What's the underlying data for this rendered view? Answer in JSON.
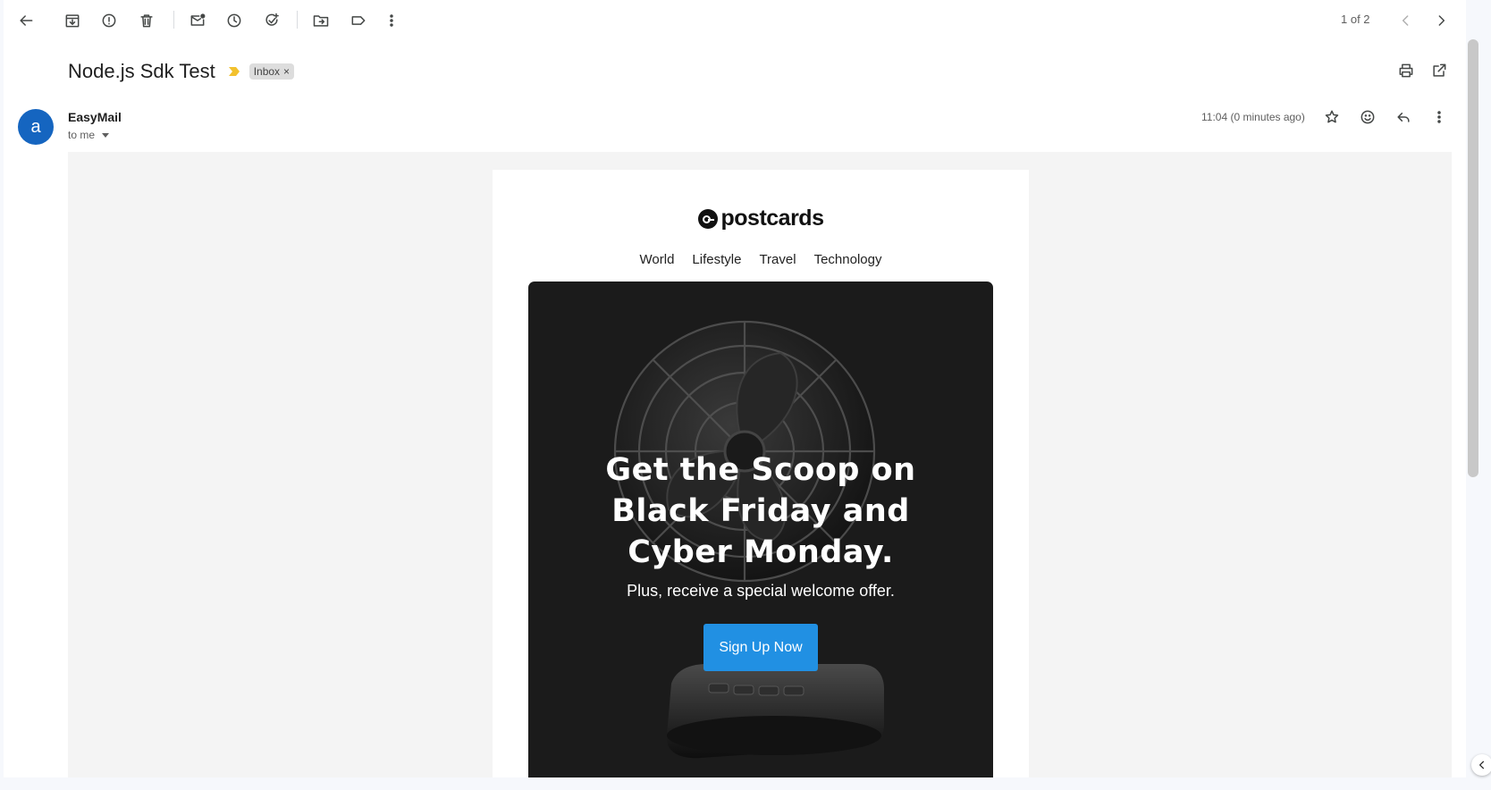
{
  "toolbar": {
    "back": "arrow-left-icon",
    "archive": "archive-icon",
    "spam": "report-spam-icon",
    "delete": "trash-icon",
    "mark_unread": "mark-unread-icon",
    "snooze": "clock-icon",
    "add_task": "add-task-icon",
    "move": "move-to-icon",
    "label": "label-icon",
    "more": "more-vert-icon"
  },
  "pager": {
    "text": "1 of 2"
  },
  "email": {
    "subject": "Node.js Sdk Test",
    "label_chip": "Inbox",
    "label_close": "×",
    "avatar_letter": "a",
    "sender_name": "EasyMail",
    "recipient": "to me",
    "time": "11:04 (0 minutes ago)"
  },
  "newsletter": {
    "brand": "postcards",
    "nav": [
      "World",
      "Lifestyle",
      "Travel",
      "Technology"
    ],
    "hero_line1": "Get the Scoop on",
    "hero_line2": "Black Friday and",
    "hero_line3": "Cyber Monday.",
    "hero_sub": "Plus, receive a special welcome offer.",
    "cta": "Sign Up Now"
  },
  "colors": {
    "avatar": "#1565c0",
    "cta": "#2190e3",
    "importance": "#f2c12e",
    "hero_bg": "#1b1b1b"
  }
}
